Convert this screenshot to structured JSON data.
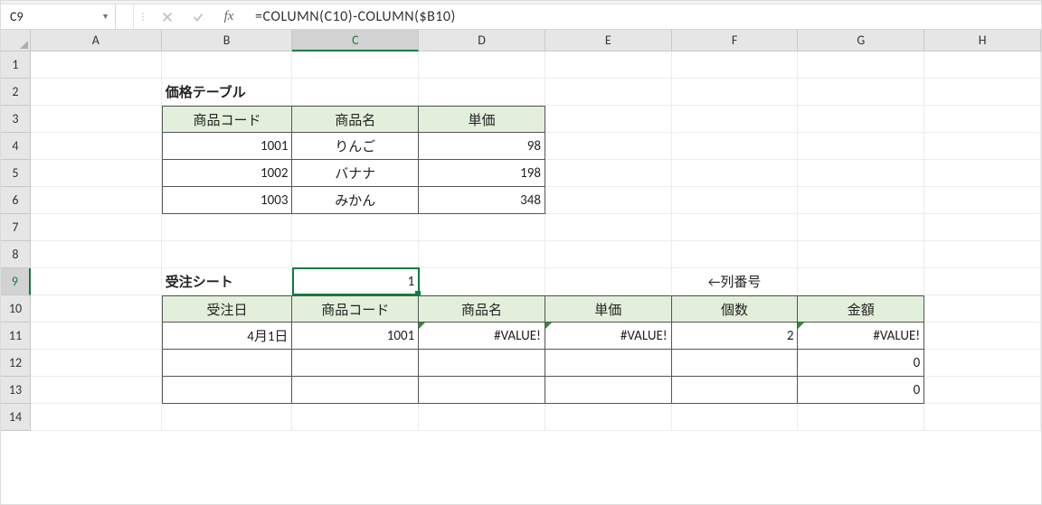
{
  "namebox": "C9",
  "formula": "=COLUMN(C10)-COLUMN($B10)",
  "columns": [
    "A",
    "B",
    "C",
    "D",
    "E",
    "F",
    "G",
    "H"
  ],
  "row_numbers": [
    "1",
    "2",
    "3",
    "4",
    "5",
    "6",
    "7",
    "8",
    "9",
    "10",
    "11",
    "12",
    "13",
    "14"
  ],
  "selected_col": "C",
  "selected_row": "9",
  "price_table": {
    "title": "価格テーブル",
    "headers": {
      "code": "商品コード",
      "name": "商品名",
      "price": "単価"
    },
    "rows": [
      {
        "code": "1001",
        "name": "りんご",
        "price": "98"
      },
      {
        "code": "1002",
        "name": "バナナ",
        "price": "198"
      },
      {
        "code": "1003",
        "name": "みかん",
        "price": "348"
      }
    ]
  },
  "order_sheet": {
    "title": "受注シート",
    "col_label_note": "←列番号",
    "c9_value": "1",
    "headers": {
      "date": "受注日",
      "code": "商品コード",
      "name": "商品名",
      "price": "単価",
      "qty": "個数",
      "amount": "金額"
    },
    "rows": [
      {
        "date": "4月1日",
        "code": "1001",
        "name": "#VALUE!",
        "price": "#VALUE!",
        "qty": "2",
        "amount": "#VALUE!"
      },
      {
        "date": "",
        "code": "",
        "name": "",
        "price": "",
        "qty": "",
        "amount": "0"
      },
      {
        "date": "",
        "code": "",
        "name": "",
        "price": "",
        "qty": "",
        "amount": "0"
      }
    ]
  },
  "chart_data": {
    "type": "table",
    "tables": [
      {
        "name": "価格テーブル",
        "columns": [
          "商品コード",
          "商品名",
          "単価"
        ],
        "rows": [
          [
            "1001",
            "りんご",
            98
          ],
          [
            "1002",
            "バナナ",
            198
          ],
          [
            "1003",
            "みかん",
            348
          ]
        ]
      },
      {
        "name": "受注シート",
        "columns": [
          "受注日",
          "商品コード",
          "商品名",
          "単価",
          "個数",
          "金額"
        ],
        "rows": [
          [
            "4月1日",
            "1001",
            "#VALUE!",
            "#VALUE!",
            2,
            "#VALUE!"
          ],
          [
            "",
            "",
            "",
            "",
            "",
            0
          ],
          [
            "",
            "",
            "",
            "",
            "",
            0
          ]
        ]
      }
    ]
  }
}
